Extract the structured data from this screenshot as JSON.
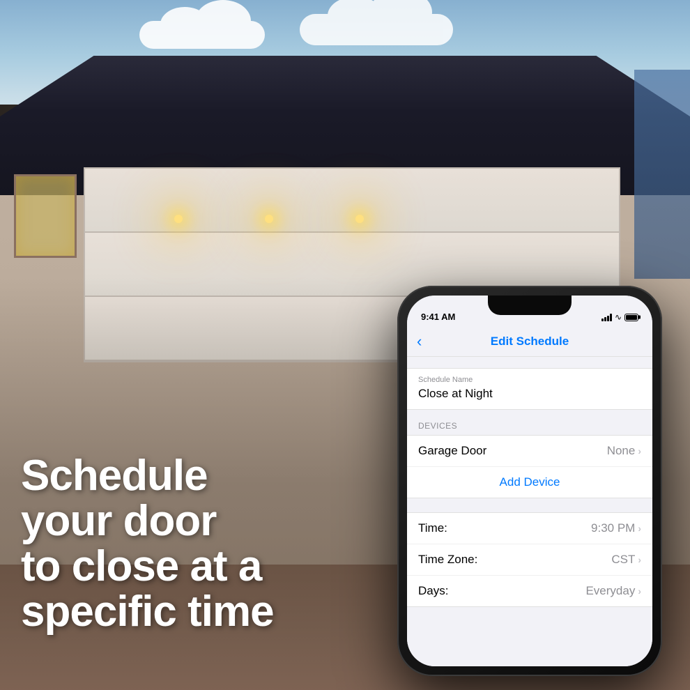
{
  "background": {
    "alt": "House with garage door at night"
  },
  "promo": {
    "line1": "Schedule",
    "line2": "your door",
    "line3": "to close at a",
    "line4": "specific time"
  },
  "phone": {
    "status_bar": {
      "time": "9:41 AM",
      "signal": "●●●",
      "wifi": "WiFi",
      "battery": "Battery"
    },
    "nav": {
      "back_label": "‹",
      "title": "Edit Schedule"
    },
    "schedule_name": {
      "label": "Schedule Name",
      "value": "Close at Night"
    },
    "devices_section": {
      "header": "DEVICES",
      "rows": [
        {
          "label": "Garage Door",
          "value": "None"
        }
      ],
      "add_device_label": "Add Device"
    },
    "settings_section": {
      "rows": [
        {
          "label": "Time:",
          "value": "9:30 PM"
        },
        {
          "label": "Time Zone:",
          "value": "CST"
        },
        {
          "label": "Days:",
          "value": "Everyday"
        }
      ]
    }
  },
  "colors": {
    "accent_blue": "#007aff",
    "text_secondary": "#8e8e93",
    "divider": "#e0e0e0"
  }
}
